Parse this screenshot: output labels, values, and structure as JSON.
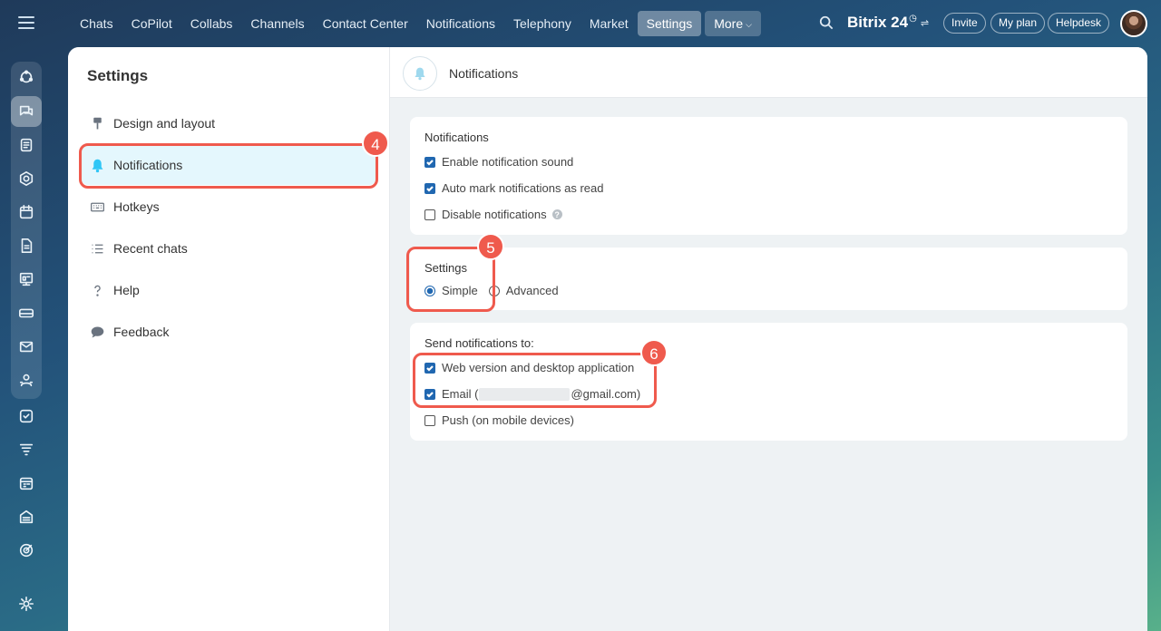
{
  "topbar": {
    "nav": [
      {
        "label": "Chats"
      },
      {
        "label": "CoPilot"
      },
      {
        "label": "Collabs"
      },
      {
        "label": "Channels"
      },
      {
        "label": "Contact Center"
      },
      {
        "label": "Notifications"
      },
      {
        "label": "Telephony"
      },
      {
        "label": "Market"
      },
      {
        "label": "Settings"
      },
      {
        "label": "More"
      }
    ],
    "brand": "Bitrix 24",
    "buttons": {
      "invite": "Invite",
      "plan": "My plan",
      "helpdesk": "Helpdesk"
    }
  },
  "sidebar": {
    "title": "Settings",
    "items": [
      {
        "label": "Design and layout",
        "icon": "paint-roller-icon"
      },
      {
        "label": "Notifications",
        "icon": "bell-icon"
      },
      {
        "label": "Hotkeys",
        "icon": "keyboard-icon"
      },
      {
        "label": "Recent chats",
        "icon": "list-icon"
      },
      {
        "label": "Help",
        "icon": "question-icon"
      },
      {
        "label": "Feedback",
        "icon": "chat-bubble-icon"
      }
    ]
  },
  "content": {
    "title": "Notifications",
    "notifications_card": {
      "title": "Notifications",
      "options": [
        {
          "label": "Enable notification sound",
          "checked": true
        },
        {
          "label": "Auto mark notifications as read",
          "checked": true
        },
        {
          "label": "Disable notifications",
          "checked": false
        }
      ]
    },
    "settings_card": {
      "title": "Settings",
      "simple": "Simple",
      "advanced": "Advanced",
      "selected": "Simple"
    },
    "send_card": {
      "title": "Send notifications to:",
      "web": "Web version and desktop application",
      "email_prefix": "Email (",
      "email_suffix": "@gmail.com)",
      "push": "Push (on mobile devices)"
    }
  },
  "annotations": [
    "4",
    "5",
    "6"
  ],
  "colors": {
    "accent": "#2fc6f6",
    "checkbox": "#2067b0",
    "highlight": "#ef5a4d"
  }
}
